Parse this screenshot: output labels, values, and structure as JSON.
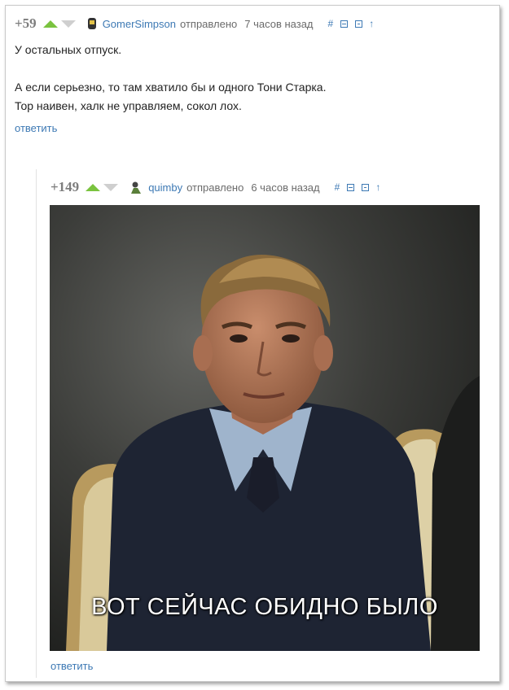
{
  "comments": [
    {
      "rating": "+59",
      "author": "GomerSimpson",
      "posted_label": "отправлено",
      "time": "7 часов назад",
      "lines": [
        "У остальных отпуск.",
        "А если серьезно, то там хватило бы и одного Тони Старка.",
        "Тор наивен, халк не управляем, сокол лох."
      ],
      "reply_label": "ответить"
    },
    {
      "rating": "+149",
      "author": "quimby",
      "posted_label": "отправлено",
      "time": "6 часов назад",
      "image_caption": "ВОТ СЕЙЧАС ОБИДНО БЫЛО",
      "reply_label": "ответить"
    }
  ],
  "action_icons": [
    "hash-icon",
    "collapse-icon",
    "save-icon",
    "parent-arrow-icon"
  ],
  "colors": {
    "link": "#3d79b4",
    "upvote": "#7ac33f",
    "downvote": "#cfcfcf",
    "rating": "#7d7d7d"
  }
}
